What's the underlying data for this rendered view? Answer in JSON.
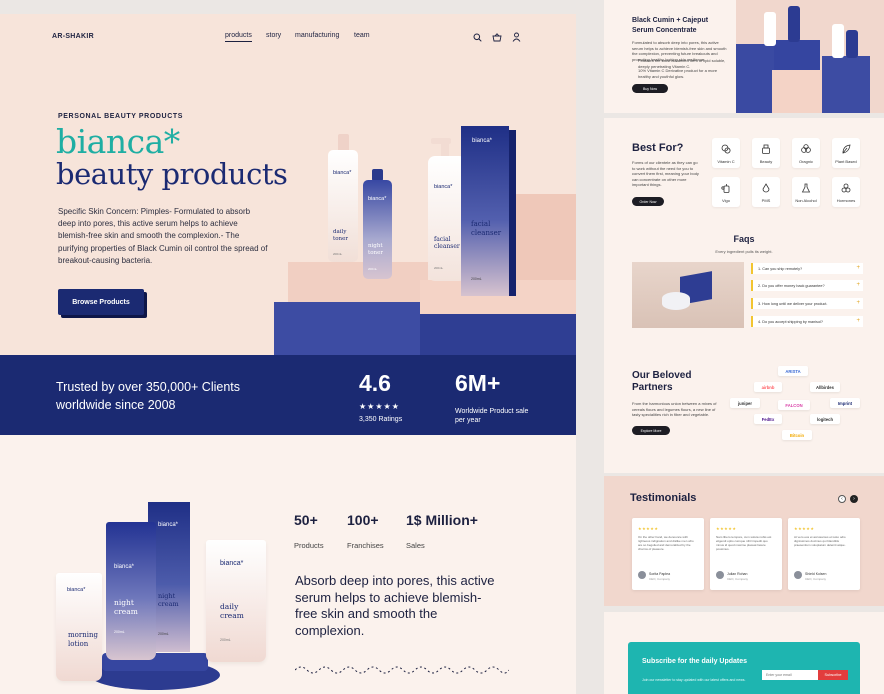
{
  "header": {
    "logo": "AR-SHAKIR",
    "nav": [
      "products",
      "story",
      "manufacturing",
      "team"
    ],
    "active_nav": "products",
    "icons": [
      "search-icon",
      "basket-icon",
      "user-icon"
    ]
  },
  "hero": {
    "eyebrow": "PERSONAL BEAUTY PRODUCTS",
    "brand": "bianca*",
    "title": "beauty products",
    "description": "Specific Skin Concern: Pimples- Formulated to absorb deep into pores, this active serum helps to achieve blemish-free skin and smooth the complexion.- The purifying properties of Black Cumin oil control the spread of breakout-causing bacteria.",
    "cta": "Browse Products",
    "products": {
      "bottle1": {
        "brand": "bianca*",
        "name": "daily toner",
        "size": "200mL"
      },
      "bottle2": {
        "brand": "bianca*",
        "name": "night toner",
        "size": "200mL"
      },
      "bottle3": {
        "brand": "bianca*",
        "name": "facial cleanser",
        "size": "200mL"
      },
      "box": {
        "brand": "bianca*",
        "name": "facial cleanser",
        "size": "200mL"
      }
    }
  },
  "stats_band": {
    "trust_text": "Trusted by over 350,000+ Clients worldwide since 2008",
    "rating": "4.6",
    "stars": "★★★★★",
    "rating_caption": "3,350 Ratings",
    "sales": "6M+",
    "sales_caption": "Worldwide Product sale per year"
  },
  "products_section": {
    "stats": [
      {
        "value": "50+",
        "label": "Products"
      },
      {
        "value": "100+",
        "label": "Franchises"
      },
      {
        "value": "1$ Million+",
        "label": "Sales"
      }
    ],
    "absorb_text": "Absorb deep into pores, this active serum helps to achieve blemish-free skin and smooth the complexion.",
    "tubes": {
      "tube1": {
        "brand": "bianca*",
        "name": "night cream",
        "size": "200mL"
      },
      "box": {
        "brand": "bianca*",
        "name": "night cream",
        "size": "200mL"
      },
      "tube2": {
        "brand": "bianca*",
        "name": "morning lotion"
      },
      "tube3": {
        "brand": "bianca*",
        "name": "daily cream",
        "size": "200mL"
      }
    }
  },
  "serum_card": {
    "title": "Black Cumin + Cajeput Serum Concentrate",
    "body": "Formulated to absorb deep into pores, this active serum helps to achieve blemish-free skin and smooth the complexion, preventing future breakouts and promoting healthy-looking skin resilience.",
    "bullets": [
      "Features the most advanced form of lipid soluble, deeply penetrating Vitamin C.",
      "10% Vitamin C Derivative product for a more healthy and youthful glow."
    ],
    "cta": "Buy Now"
  },
  "best_for": {
    "title": "Best For?",
    "body": "Forms of our clientele as they can go to work without the need for you to convert them first, meaning your body can concentrate on other more important things.",
    "cta": "Order Now",
    "items": [
      {
        "label": "Vitamin C",
        "icon": "vitamin-icon"
      },
      {
        "label": "Beauty",
        "icon": "beauty-icon"
      },
      {
        "label": "Oragnic",
        "icon": "organic-icon"
      },
      {
        "label": "Plant Based",
        "icon": "leaf-icon"
      },
      {
        "label": "Vigo",
        "icon": "vigo-icon"
      },
      {
        "label": "PMS",
        "icon": "drop-icon"
      },
      {
        "label": "Non Alcohol",
        "icon": "flask-icon"
      },
      {
        "label": "Hormones",
        "icon": "hormones-icon"
      }
    ]
  },
  "faqs": {
    "title": "Faqs",
    "subtitle": "Every ingredient pulls its weight.",
    "items": [
      "1. Can you ship remotely?",
      "2. Do you offer money back guarantee?",
      "3. How long until we deliver your product.",
      "4. Do you accept shipping by manisol?"
    ]
  },
  "partners": {
    "title": "Our Beloved Partners",
    "body": "From the harmonious union between a mixes of cereals flours and legumes flours, a new line of tasty specialities rich in fiber and vegetable.",
    "cta": "Explore More",
    "logos": [
      "ARISTA",
      "airbnb",
      "Allbirdes",
      "juniper",
      "FALCON",
      "Imprint",
      "FedEx",
      "logitech",
      "Bitcoin"
    ]
  },
  "testimonials": {
    "title": "Testimonials",
    "cards": [
      {
        "stars": "★★★★★",
        "text": "On the other hand, we denounce with righteous indignation and dislike men who are so beguiled and demoralized by the charms of pleasure.",
        "name": "Sorita Paplea",
        "role": "CEO, Company"
      },
      {
        "stars": "★★★★★",
        "text": "Nam libero tempore, cum soluta nobis est eligendi optio cumque nihil impedit quo minus id quod maxime placeat facere possimus.",
        "name": "Julian Rohan",
        "role": "CEO, Company"
      },
      {
        "stars": "★★★★★",
        "text": "At vero eos et accusamus et iusto odio dignissimos ducimus qui blanditiis praesentium voluptatum deleniti atque.",
        "name": "Shield Kolsen",
        "role": "CEO, Company"
      }
    ]
  },
  "subscribe": {
    "title": "Subscribe for the daily Updates",
    "body": "Join our newsletter to stay updated with our latest offers and news.",
    "placeholder": "Enter your email",
    "cta": "Subscribe"
  },
  "colors": {
    "navy": "#1b2a72",
    "teal": "#1faea3",
    "peach": "#f7e4da",
    "pink_block": "#f4d3c6",
    "subscribe_bg": "#1eb5b0",
    "subscribe_btn": "#e23d3d",
    "faq_accent": "#f2c530"
  }
}
